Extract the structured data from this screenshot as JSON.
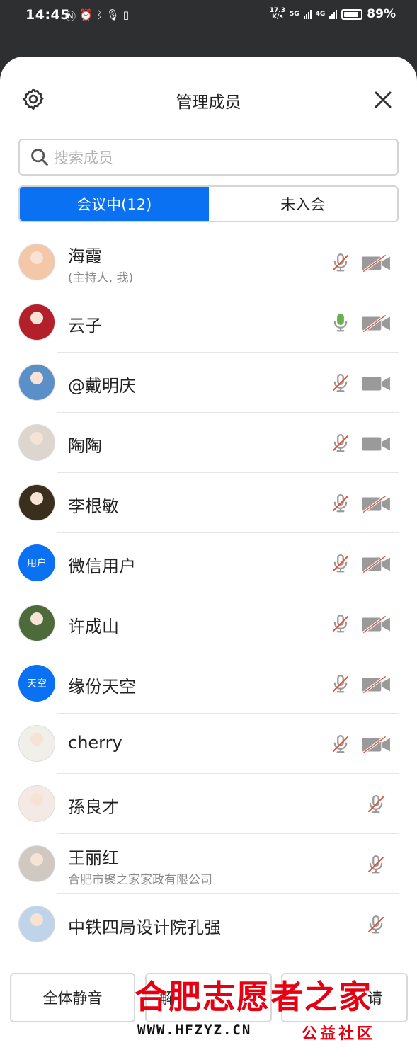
{
  "status_bar": {
    "time": "14:45",
    "net_speed_value": "17.3",
    "net_speed_unit": "K/s",
    "sig1_label": "5G",
    "sig2_label": "4G",
    "battery": "89%"
  },
  "header": {
    "title": "管理成员"
  },
  "search": {
    "placeholder": "搜索成员"
  },
  "tabs": [
    {
      "label": "会议中(12)",
      "active": true
    },
    {
      "label": "未入会",
      "active": false
    }
  ],
  "members": [
    {
      "name": "海霞",
      "sub": "(主持人, 我)",
      "mic": "muted",
      "cam": "off"
    },
    {
      "name": "云子",
      "sub": "",
      "mic": "on",
      "cam": "off"
    },
    {
      "name": "@戴明庆",
      "sub": "",
      "mic": "muted",
      "cam": "on"
    },
    {
      "name": "陶陶",
      "sub": "",
      "mic": "muted",
      "cam": "on"
    },
    {
      "name": "李根敏",
      "sub": "",
      "mic": "muted",
      "cam": "off"
    },
    {
      "name": "微信用户",
      "sub": "",
      "mic": "muted",
      "cam": "off",
      "avatar_text": "用户"
    },
    {
      "name": "许成山",
      "sub": "",
      "mic": "muted",
      "cam": "off"
    },
    {
      "name": "缘份天空",
      "sub": "",
      "mic": "muted",
      "cam": "off",
      "avatar_text": "天空"
    },
    {
      "name": "cherry",
      "sub": "",
      "mic": "muted",
      "cam": "off"
    },
    {
      "name": "孫良才",
      "sub": "",
      "mic": "muted"
    },
    {
      "name": "王丽红",
      "sub": "合肥市聚之家家政有限公司",
      "mic": "muted"
    },
    {
      "name": "中铁四局设计院孔强",
      "sub": "",
      "mic": "muted"
    }
  ],
  "footer": {
    "mute_all": "全体静音",
    "unmute_all_visible": "解",
    "invite_visible": "请"
  },
  "watermark": {
    "title": "合肥志愿者之家",
    "url": "WWW.HFZYZ.CN",
    "tagline": "公益社区"
  },
  "colors": {
    "accent": "#0a72f2",
    "muted_slash": "#e0533c",
    "mic_on": "#6ab04c",
    "icon_gray": "#9a9a9a"
  }
}
